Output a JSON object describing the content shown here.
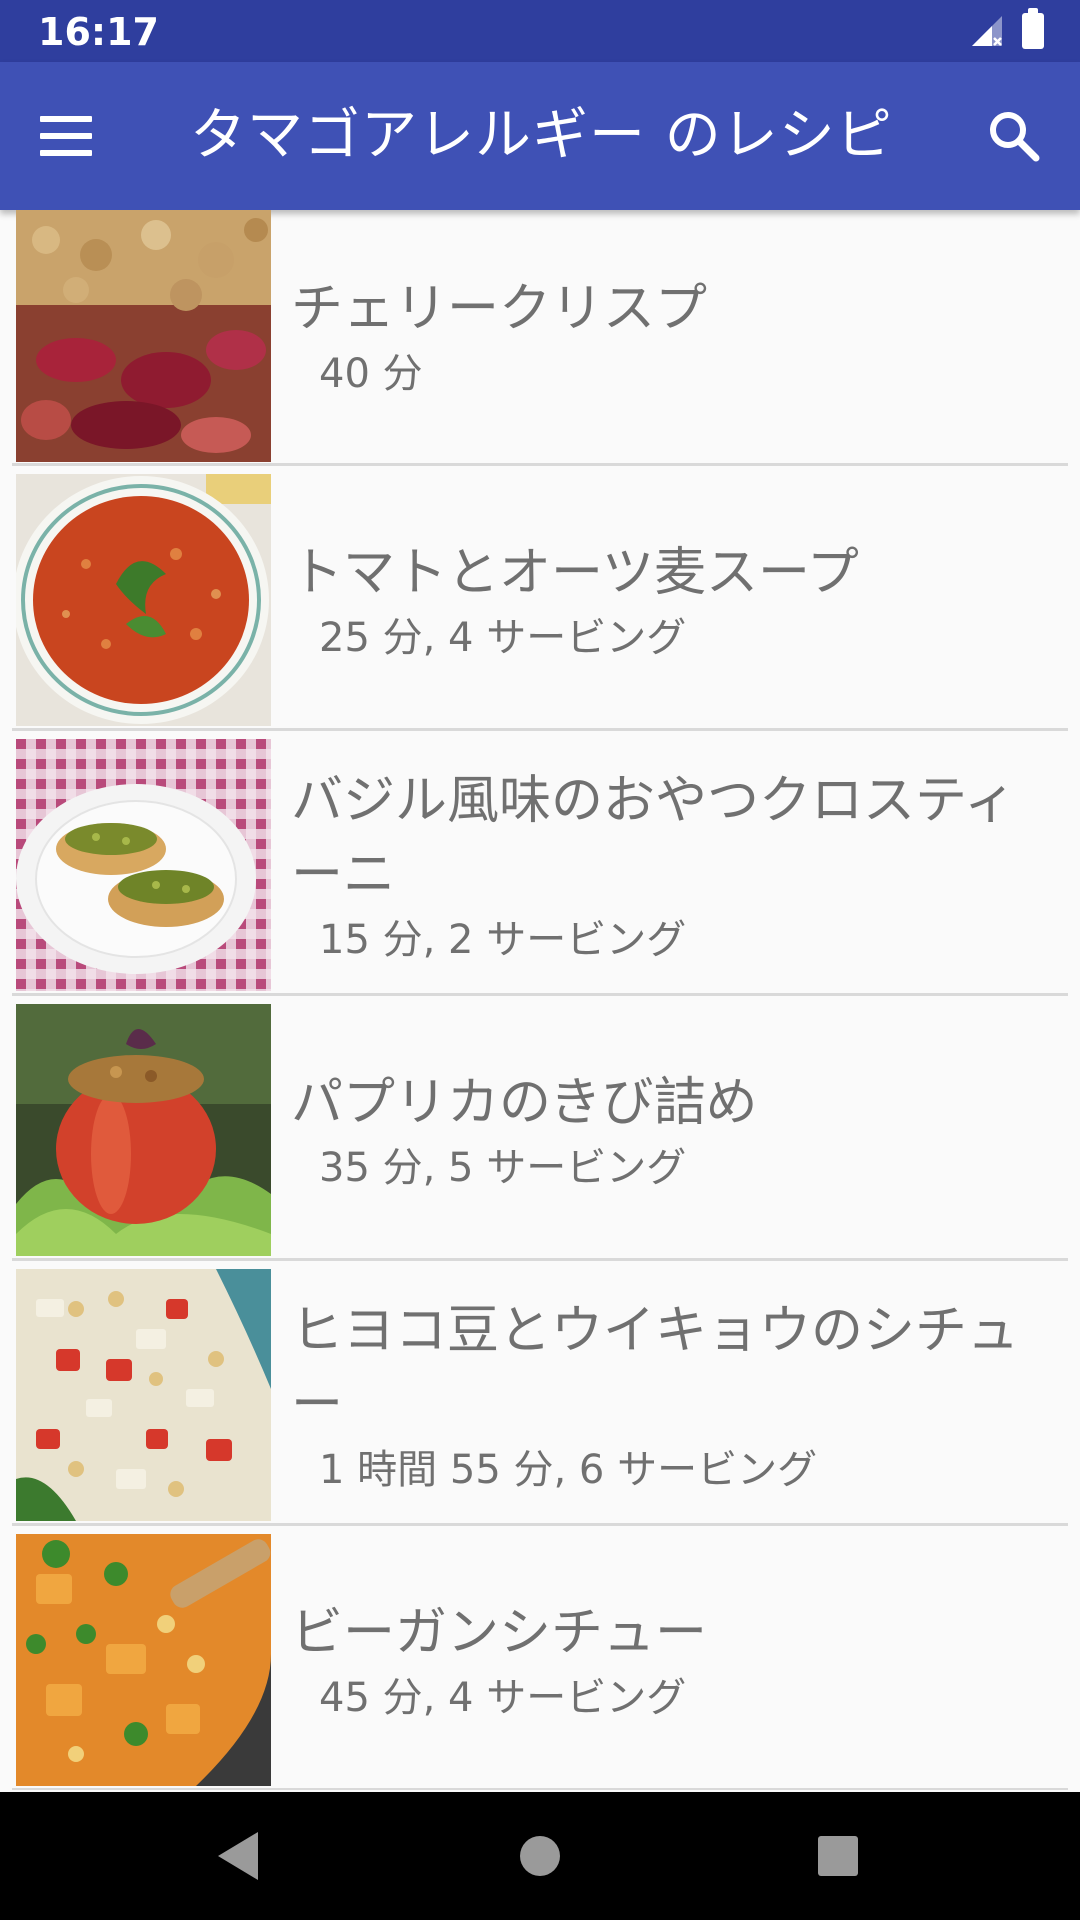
{
  "status_bar": {
    "time": "16:17"
  },
  "app_bar": {
    "title": "タマゴアレルギー のレシピ"
  },
  "recipes": [
    {
      "title": "チェリークリスプ",
      "meta": "40 分"
    },
    {
      "title": "トマトとオーツ麦スープ",
      "meta": "25 分, 4 サービング"
    },
    {
      "title": "バジル風味のおやつクロスティーニ",
      "meta": "15 分, 2 サービング"
    },
    {
      "title": "パプリカのきび詰め",
      "meta": "35 分, 5 サービング"
    },
    {
      "title": "ヒヨコ豆とウイキョウのシチュー",
      "meta": "1 時間 55 分, 6 サービング"
    },
    {
      "title": "ビーガンシチュー",
      "meta": "45 分, 4 サービング"
    }
  ],
  "colors": {
    "status_bar": "#2f3e9e",
    "app_bar": "#3f51b5",
    "background": "#fafafa",
    "nav_bar": "#000000"
  }
}
